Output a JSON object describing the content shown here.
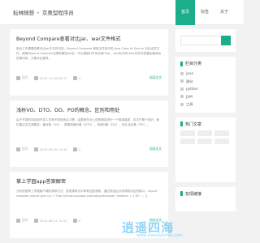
{
  "brand": {
    "site": "耘林随想",
    "section": "京奥型程序员"
  },
  "nav": [
    "首页",
    "标签",
    "关于"
  ],
  "posts": [
    {
      "title": "Beyond Compare查看对比jar、war文件格式",
      "excerpt": "因为工作需要查看对比jar中文件内容，Beyond Compare 使用文件夹中的 Java Class to Source 对比这些文件，使用Beyond Compare无需先解压jar包，可以直接打开对比两个jar、war包中的class文件并查看反编译后的源代码，方便对比差异。",
      "author": "田可",
      "date": "2019-11-05 09:17",
      "views": "0",
      "more": "阅读全文"
    },
    {
      "title": "浅析VO、DTO、DO、PO的概念、区别和用处",
      "excerpt": "由于不同的项目和开发人员有不同的命名习惯，这里首先对上述的概念进行一个简单描述，名字只是个标识，我们重点关注其概念：值对象（VO）、数据传输对象（DTO）、领域对象（DO）、持久化对象（PO）。",
      "author": "田可",
      "date": "2019-09-25 14:45",
      "views": "0",
      "more": "阅读全文"
    },
    {
      "title": "掌上学园app答案解密",
      "excerpt": "分析的是掌上学园客户端的请求方式，发现请求头中带有加密参数，通过抓包后分析得到对应的接口，import requests import json url = 'http://study.zsxyapp.com/api/getAnswer' headers = {'ID': '...'}",
      "author": "田可",
      "date": "2019-08-21 10:12",
      "views": "0",
      "more": "阅读全文"
    }
  ],
  "sidebar": {
    "categories_title": "栏目分类",
    "categories": [
      "java",
      "建站",
      "python",
      "JVM",
      "工具"
    ],
    "friends_title": "热门文章",
    "links_title": "友情链接"
  },
  "watermark": {
    "main": "逍遥四海",
    "sub": "www.xiaoyaosihai.com"
  },
  "colors": {
    "accent": "#1cae8a",
    "watermark": "#36aeee"
  }
}
